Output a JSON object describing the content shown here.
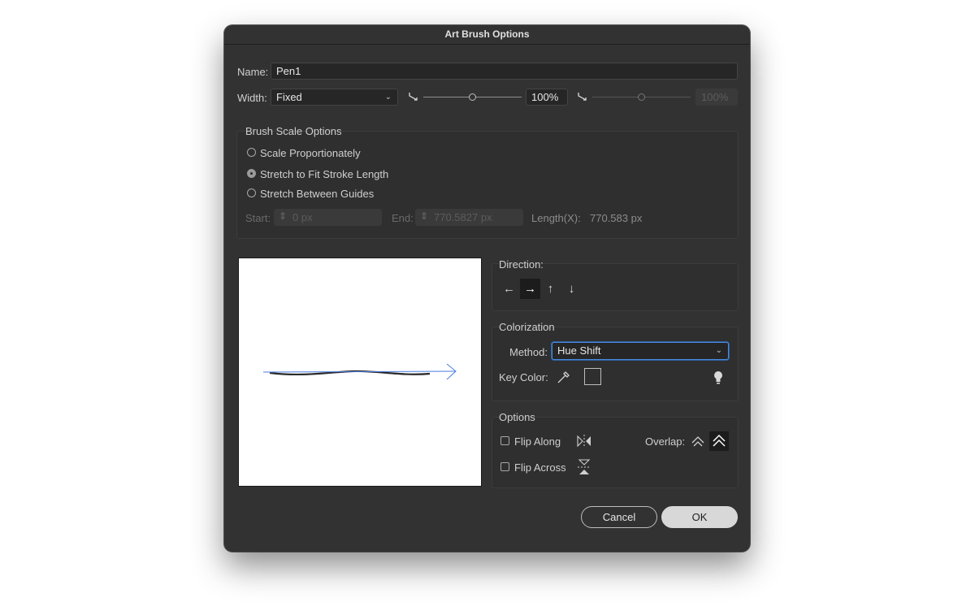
{
  "dialog": {
    "title": "Art Brush Options"
  },
  "name": {
    "label": "Name:",
    "value": "Pen1"
  },
  "width": {
    "label": "Width:",
    "mode": "Fixed",
    "value": "100%",
    "value_disabled": "100%",
    "slider_position": 0.5
  },
  "scale": {
    "legend": "Brush Scale Options",
    "options": [
      "Scale Proportionately",
      "Stretch to Fit Stroke Length",
      "Stretch Between Guides"
    ],
    "selected_index": 1,
    "start_label": "Start:",
    "start_value": "0 px",
    "end_label": "End:",
    "end_value": "770.5827 px",
    "length_label": "Length(X):",
    "length_value": "770.583 px"
  },
  "direction": {
    "label": "Direction:",
    "buttons": [
      "←",
      "→",
      "↑",
      "↓"
    ],
    "active_index": 1
  },
  "colorization": {
    "legend": "Colorization",
    "method_label": "Method:",
    "method_value": "Hue Shift",
    "key_color_label": "Key Color:"
  },
  "options": {
    "legend": "Options",
    "flip_along": "Flip Along",
    "flip_across": "Flip Across",
    "overlap_label": "Overlap:"
  },
  "buttons": {
    "cancel": "Cancel",
    "ok": "OK"
  },
  "colors": {
    "accent_focus": "#4a8be0",
    "preview_arrow": "#4a7be0"
  },
  "icons": {
    "width_left": "taper-icon",
    "width_right": "taper-icon",
    "eyedropper": "eyedropper-icon",
    "tips": "lightbulb-icon",
    "flip_along": "flip-along-icon",
    "flip_across": "flip-across-icon",
    "overlap_adjust": "overlap-adjust-icon",
    "overlap_none": "overlap-none-icon"
  }
}
